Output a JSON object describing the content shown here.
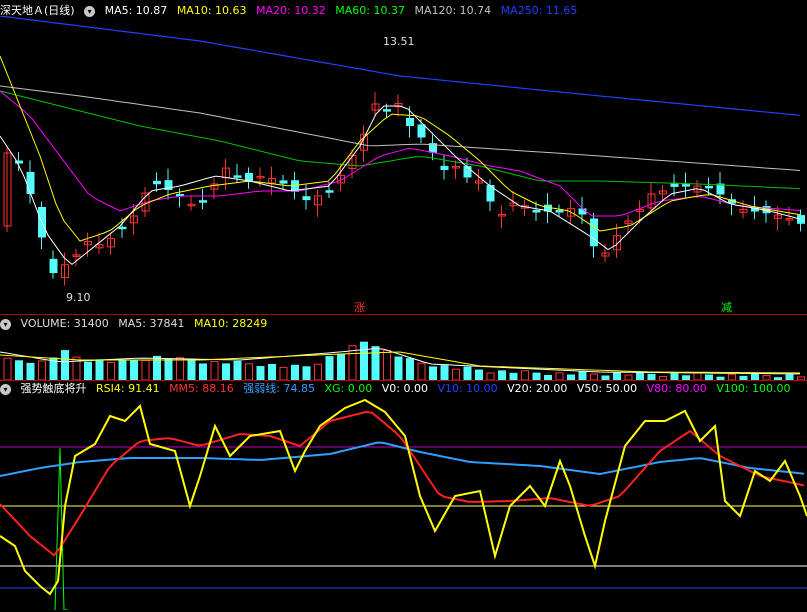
{
  "main": {
    "stock_name": "深天地Ａ",
    "period": "(日线)",
    "ma": [
      {
        "label": "MA5: 10.87",
        "color": "#ffffff"
      },
      {
        "label": "MA10: 10.63",
        "color": "#ffff00"
      },
      {
        "label": "MA20: 10.32",
        "color": "#ff00ff"
      },
      {
        "label": "MA60: 10.37",
        "color": "#00ff00"
      },
      {
        "label": "MA120: 10.74",
        "color": "#c0c0c0"
      },
      {
        "label": "MA250: 11.65",
        "color": "#2040ff"
      }
    ],
    "high_label": "13.51",
    "low_label": "9.10",
    "mark_up": "涨",
    "mark_down": "减"
  },
  "volume": {
    "title": "VOLUME: 31400",
    "ma5": "MA5: 37841",
    "ma10": "MA10: 28249"
  },
  "indicator": {
    "name": "强势触底将升",
    "items": [
      {
        "label": "RSI4: 91.41",
        "color": "#ffff00"
      },
      {
        "label": "MM5: 88.16",
        "color": "#ff3030"
      },
      {
        "label": "强弱线: 74.85",
        "color": "#30a0ff"
      },
      {
        "label": "XG: 0.00",
        "color": "#00ff00"
      },
      {
        "label": "V0: 0.00",
        "color": "#ffffff"
      },
      {
        "label": "V10: 10.00",
        "color": "#2040ff"
      },
      {
        "label": "V20: 20.00",
        "color": "#ffffff"
      },
      {
        "label": "V50: 50.00",
        "color": "#ffffff"
      },
      {
        "label": "V80: 80.00",
        "color": "#ff00ff"
      },
      {
        "label": "V100: 100.00",
        "color": "#00ff00"
      }
    ]
  },
  "colors": {
    "up": "#ff3232",
    "down": "#54fcfc",
    "bg": "#000000"
  }
}
